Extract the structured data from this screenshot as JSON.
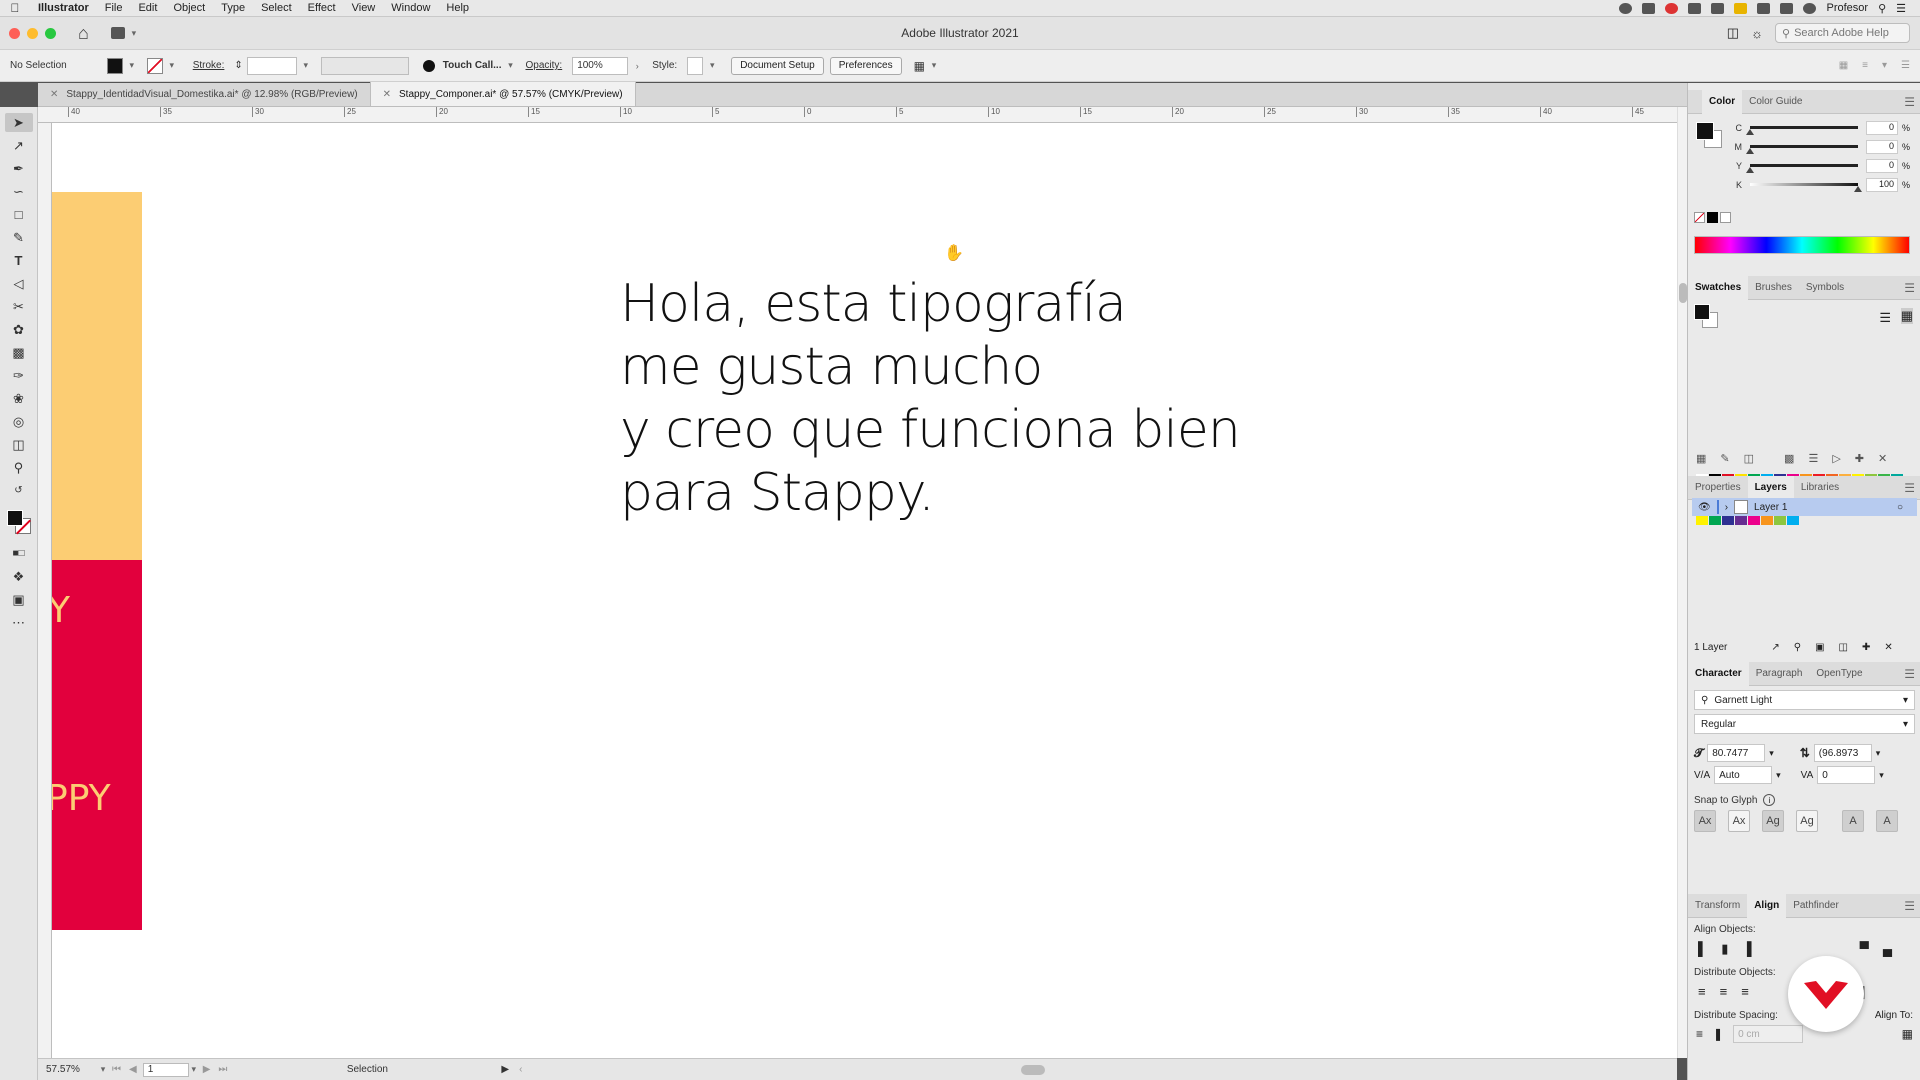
{
  "menubar": {
    "app_name": "Illustrator",
    "items": [
      "File",
      "Edit",
      "Object",
      "Type",
      "Select",
      "Effect",
      "View",
      "Window",
      "Help"
    ],
    "user": "Profesor"
  },
  "titlebar": {
    "title": "Adobe Illustrator 2021",
    "search_placeholder": "Search Adobe Help"
  },
  "controlbar": {
    "selection": "No Selection",
    "stroke_label": "Stroke:",
    "brush_label": "Touch Call...",
    "opacity_label": "Opacity:",
    "opacity_value": "100%",
    "style_label": "Style:",
    "doc_setup": "Document Setup",
    "preferences": "Preferences"
  },
  "tabs": [
    {
      "label": "Stappy_IdentidadVisual_Domestika.ai* @ 12.98% (RGB/Preview)",
      "active": false
    },
    {
      "label": "Stappy_Componer.ai* @ 57.57% (CMYK/Preview)",
      "active": true
    }
  ],
  "ruler": {
    "ticks": [
      "40",
      "35",
      "30",
      "25",
      "20",
      "15",
      "10",
      "5",
      "0",
      "5",
      "10",
      "15",
      "20",
      "25",
      "30",
      "35",
      "40",
      "45"
    ]
  },
  "canvas": {
    "headline_lines": [
      "Hola, esta tipografía",
      "me gusta mucho",
      "y creo que funciona bien",
      "para Stappy."
    ],
    "art_text_1": "Y",
    "art_text_2": "PPY"
  },
  "statusbar": {
    "zoom": "57.57%",
    "artboard": "1",
    "tool": "Selection"
  },
  "panels": {
    "color": {
      "tabs": [
        "Color",
        "Color Guide"
      ],
      "channels": [
        {
          "label": "C",
          "value": "0",
          "unit": "%",
          "level": 0
        },
        {
          "label": "M",
          "value": "0",
          "unit": "%",
          "level": 0
        },
        {
          "label": "Y",
          "value": "0",
          "unit": "%",
          "level": 0
        },
        {
          "label": "K",
          "value": "100",
          "unit": "%",
          "level": 1
        }
      ]
    },
    "swatches": {
      "tabs": [
        "Swatches",
        "Brushes",
        "Symbols"
      ]
    },
    "layers": {
      "tabs": [
        "Properties",
        "Layers",
        "Libraries"
      ],
      "layer_name": "Layer 1",
      "count": "1 Layer"
    },
    "character": {
      "tabs": [
        "Character",
        "Paragraph",
        "OpenType"
      ],
      "font": "Garnett Light",
      "style": "Regular",
      "size": "80.7477",
      "leading": "(96.8973",
      "kerning": "Auto",
      "tracking": "0",
      "snap_label": "Snap to Glyph"
    },
    "align": {
      "tabs": [
        "Transform",
        "Align",
        "Pathfinder"
      ],
      "align_objects": "Align Objects:",
      "distribute_objects": "Distribute Objects:",
      "distribute_spacing": "Distribute Spacing:",
      "align_to": "Align To:",
      "spacing_value": "0 cm"
    }
  },
  "colors": {
    "art_yellow": "#fccd73",
    "art_red": "#e2003d",
    "accent_red": "#e10f24",
    "layer_highlight": "#b7cbef"
  }
}
